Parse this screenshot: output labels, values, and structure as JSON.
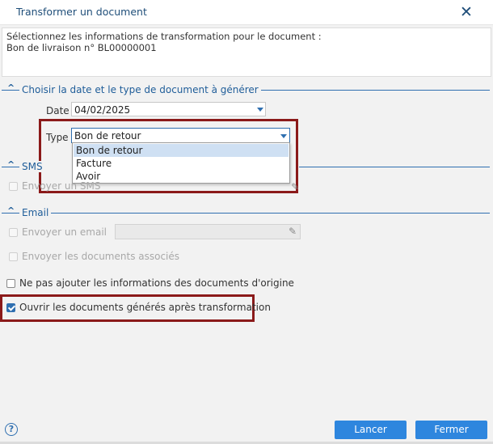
{
  "window": {
    "title": "Transformer un document",
    "close_glyph": "✕"
  },
  "instructions": {
    "line1": "Sélectionnez les informations de transformation pour le document :",
    "line2": "Bon de livraison n° BL00000001"
  },
  "section_generate": {
    "toggle_glyph": "^",
    "title": "Choisir la date et le type de document à générer",
    "date_label": "Date",
    "date_value": "04/02/2025",
    "type_label": "Type",
    "type_value": "Bon de retour",
    "type_options": [
      "Bon de retour",
      "Facture",
      "Avoir"
    ],
    "selected_option_index": 0
  },
  "section_sms": {
    "toggle_glyph": "^",
    "title": "SMS",
    "send_sms_label": "Envoyer un SMS",
    "send_sms_checked": false
  },
  "section_email": {
    "toggle_glyph": "^",
    "title": "Email",
    "send_email_label": "Envoyer un email",
    "send_email_checked": false,
    "send_docs_label": "Envoyer les documents associés",
    "send_docs_checked": false
  },
  "options": {
    "no_origin_info_label": "Ne pas ajouter les informations des documents d'origine",
    "no_origin_info_checked": false,
    "open_after_label": "Ouvrir les documents générés après transformation",
    "open_after_checked": true
  },
  "footer": {
    "help_glyph": "?",
    "cancel_label": "Lancer",
    "close_label": "Fermer"
  },
  "colors": {
    "accent": "#2e86de",
    "section_blue": "#1f5d99",
    "highlight": "#8b1a1a"
  },
  "icons": {
    "close": "close-icon",
    "collapse": "chevron-up-icon",
    "dropdown": "chevron-down-icon",
    "edit": "pencil-icon",
    "help": "help-icon"
  }
}
